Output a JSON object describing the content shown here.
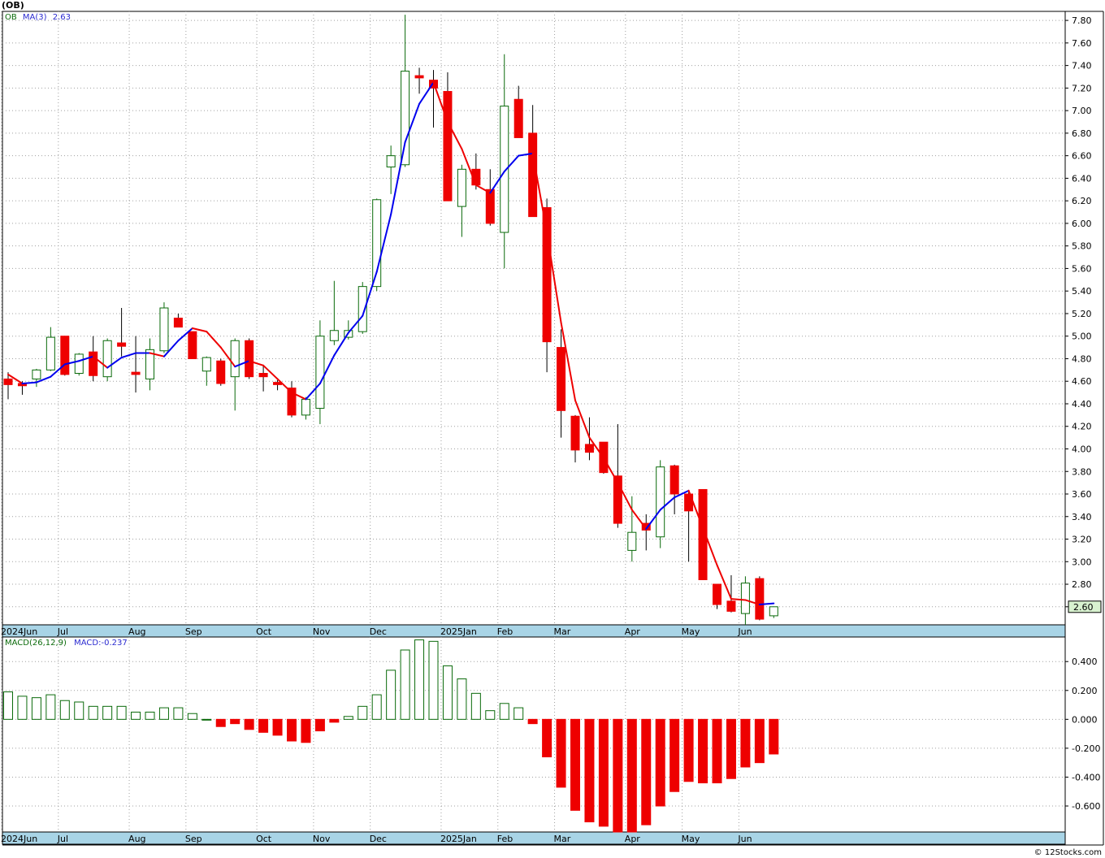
{
  "title": "(OB)",
  "price_legend": {
    "symbol": "OB",
    "ma_label": "MA(3)",
    "ma_value": "2.63"
  },
  "macd_legend": {
    "label": "MACD(26,12,9)",
    "value_label": "MACD:-0.237"
  },
  "last_price_label": "2.60",
  "credit": "© 12Stocks.com",
  "colors": {
    "up": "#0a6a0a",
    "down": "#ee0000",
    "ma_up": "#0000ee",
    "ma_down": "#ee0000",
    "axis_band": "#a8d4e6",
    "grid": "#a0a0a0",
    "price_tag": "#d8f2d0"
  },
  "chart_data": [
    {
      "type": "candlestick",
      "ylim": [
        2.44,
        7.88
      ],
      "y_ticks": [
        "7.80",
        "7.60",
        "7.40",
        "7.20",
        "7.00",
        "6.80",
        "6.60",
        "6.40",
        "6.20",
        "6.00",
        "5.80",
        "5.60",
        "5.40",
        "5.20",
        "5.00",
        "4.80",
        "4.60",
        "4.40",
        "4.20",
        "4.00",
        "3.80",
        "3.60",
        "3.40",
        "3.20",
        "3.00",
        "2.80",
        "2.60"
      ],
      "x_labels": [
        {
          "i": 0,
          "label": "2024Jun"
        },
        {
          "i": 4,
          "label": "Jul"
        },
        {
          "i": 9,
          "label": "Aug"
        },
        {
          "i": 13,
          "label": "Sep"
        },
        {
          "i": 18,
          "label": "Oct"
        },
        {
          "i": 22,
          "label": "Nov"
        },
        {
          "i": 26,
          "label": "Dec"
        },
        {
          "i": 31,
          "label": "2025Jan"
        },
        {
          "i": 35,
          "label": "Feb"
        },
        {
          "i": 39,
          "label": "Mar"
        },
        {
          "i": 44,
          "label": "Apr"
        },
        {
          "i": 48,
          "label": "May"
        },
        {
          "i": 52,
          "label": "Jun"
        }
      ],
      "candles": [
        {
          "o": 4.62,
          "h": 4.68,
          "l": 4.44,
          "c": 4.57
        },
        {
          "o": 4.58,
          "h": 4.6,
          "l": 4.48,
          "c": 4.56
        },
        {
          "o": 4.62,
          "h": 4.71,
          "l": 4.55,
          "c": 4.7
        },
        {
          "o": 4.7,
          "h": 5.08,
          "l": 4.69,
          "c": 4.99
        },
        {
          "o": 5.0,
          "h": 5.0,
          "l": 4.65,
          "c": 4.66
        },
        {
          "o": 4.67,
          "h": 4.85,
          "l": 4.65,
          "c": 4.84
        },
        {
          "o": 4.86,
          "h": 5.0,
          "l": 4.6,
          "c": 4.65
        },
        {
          "o": 4.64,
          "h": 4.98,
          "l": 4.6,
          "c": 4.96
        },
        {
          "o": 4.94,
          "h": 5.25,
          "l": 4.82,
          "c": 4.91
        },
        {
          "o": 4.68,
          "h": 5.0,
          "l": 4.5,
          "c": 4.66
        },
        {
          "o": 4.62,
          "h": 4.98,
          "l": 4.52,
          "c": 4.88
        },
        {
          "o": 4.87,
          "h": 5.3,
          "l": 4.85,
          "c": 5.25
        },
        {
          "o": 5.16,
          "h": 5.2,
          "l": 5.08,
          "c": 5.08
        },
        {
          "o": 5.04,
          "h": 5.04,
          "l": 4.8,
          "c": 4.8
        },
        {
          "o": 4.69,
          "h": 4.82,
          "l": 4.56,
          "c": 4.81
        },
        {
          "o": 4.78,
          "h": 4.8,
          "l": 4.56,
          "c": 4.58
        },
        {
          "o": 4.64,
          "h": 4.98,
          "l": 4.34,
          "c": 4.96
        },
        {
          "o": 4.96,
          "h": 4.98,
          "l": 4.62,
          "c": 4.64
        },
        {
          "o": 4.67,
          "h": 4.74,
          "l": 4.51,
          "c": 4.64
        },
        {
          "o": 4.59,
          "h": 4.61,
          "l": 4.52,
          "c": 4.57
        },
        {
          "o": 4.54,
          "h": 4.6,
          "l": 4.28,
          "c": 4.3
        },
        {
          "o": 4.3,
          "h": 4.46,
          "l": 4.26,
          "c": 4.44
        },
        {
          "o": 4.36,
          "h": 5.14,
          "l": 4.22,
          "c": 5.0
        },
        {
          "o": 4.96,
          "h": 5.49,
          "l": 4.92,
          "c": 5.05
        },
        {
          "o": 4.99,
          "h": 5.14,
          "l": 4.97,
          "c": 5.05
        },
        {
          "o": 5.04,
          "h": 5.48,
          "l": 5.02,
          "c": 5.44
        },
        {
          "o": 5.44,
          "h": 6.22,
          "l": 5.4,
          "c": 6.21
        },
        {
          "o": 6.5,
          "h": 6.69,
          "l": 6.26,
          "c": 6.6
        },
        {
          "o": 6.52,
          "h": 7.85,
          "l": 6.5,
          "c": 7.35
        },
        {
          "o": 7.31,
          "h": 7.38,
          "l": 7.15,
          "c": 7.29
        },
        {
          "o": 7.27,
          "h": 7.36,
          "l": 6.85,
          "c": 7.2
        },
        {
          "o": 7.17,
          "h": 7.34,
          "l": 6.2,
          "c": 6.2
        },
        {
          "o": 6.15,
          "h": 6.52,
          "l": 5.88,
          "c": 6.48
        },
        {
          "o": 6.48,
          "h": 6.62,
          "l": 6.3,
          "c": 6.34
        },
        {
          "o": 6.3,
          "h": 6.48,
          "l": 5.98,
          "c": 6.0
        },
        {
          "o": 5.92,
          "h": 7.5,
          "l": 5.6,
          "c": 7.04
        },
        {
          "o": 7.1,
          "h": 7.22,
          "l": 6.76,
          "c": 6.76
        },
        {
          "o": 6.8,
          "h": 7.05,
          "l": 6.06,
          "c": 6.06
        },
        {
          "o": 6.14,
          "h": 6.22,
          "l": 4.68,
          "c": 4.95
        },
        {
          "o": 4.9,
          "h": 5.06,
          "l": 4.1,
          "c": 4.34
        },
        {
          "o": 4.29,
          "h": 4.3,
          "l": 3.88,
          "c": 3.99
        },
        {
          "o": 4.04,
          "h": 4.28,
          "l": 3.9,
          "c": 3.97
        },
        {
          "o": 4.06,
          "h": 4.06,
          "l": 3.78,
          "c": 3.79
        },
        {
          "o": 3.76,
          "h": 4.22,
          "l": 3.3,
          "c": 3.34
        },
        {
          "o": 3.1,
          "h": 3.58,
          "l": 3.0,
          "c": 3.26
        },
        {
          "o": 3.34,
          "h": 3.42,
          "l": 3.1,
          "c": 3.28
        },
        {
          "o": 3.22,
          "h": 3.9,
          "l": 3.12,
          "c": 3.84
        },
        {
          "o": 3.85,
          "h": 3.86,
          "l": 3.42,
          "c": 3.6
        },
        {
          "o": 3.6,
          "h": 3.62,
          "l": 3.0,
          "c": 3.45
        },
        {
          "o": 3.64,
          "h": 3.64,
          "l": 2.84,
          "c": 2.84
        },
        {
          "o": 2.8,
          "h": 2.8,
          "l": 2.58,
          "c": 2.62
        },
        {
          "o": 2.65,
          "h": 2.88,
          "l": 2.55,
          "c": 2.56
        },
        {
          "o": 2.54,
          "h": 2.87,
          "l": 2.44,
          "c": 2.81
        },
        {
          "o": 2.85,
          "h": 2.87,
          "l": 2.48,
          "c": 2.49
        },
        {
          "o": 2.52,
          "h": 2.6,
          "l": 2.5,
          "c": 2.6
        }
      ],
      "ma3": [
        4.66,
        4.58,
        4.59,
        4.64,
        4.75,
        4.78,
        4.82,
        4.72,
        4.81,
        4.85,
        4.85,
        4.82,
        4.96,
        5.07,
        5.04,
        4.9,
        4.73,
        4.78,
        4.74,
        4.62,
        4.5,
        4.44,
        4.58,
        4.83,
        5.03,
        5.18,
        5.57,
        6.08,
        6.72,
        7.06,
        7.25,
        6.9,
        6.66,
        6.34,
        6.27,
        6.46,
        6.6,
        6.62,
        5.92,
        5.12,
        4.43,
        4.1,
        3.92,
        3.7,
        3.46,
        3.29,
        3.46,
        3.57,
        3.63,
        3.3,
        2.97,
        2.67,
        2.66,
        2.62,
        2.63
      ]
    },
    {
      "type": "bar",
      "name": "MACD(26,12,9)",
      "ylim": [
        -0.78,
        0.57
      ],
      "y_ticks": [
        "0.400",
        "0.200",
        "0.000",
        "-0.200",
        "-0.400",
        "-0.600"
      ],
      "values": [
        0.19,
        0.16,
        0.15,
        0.17,
        0.13,
        0.12,
        0.09,
        0.09,
        0.09,
        0.05,
        0.05,
        0.08,
        0.08,
        0.04,
        0.0,
        -0.05,
        -0.03,
        -0.07,
        -0.09,
        -0.11,
        -0.15,
        -0.16,
        -0.08,
        -0.02,
        0.02,
        0.09,
        0.17,
        0.34,
        0.48,
        0.55,
        0.54,
        0.37,
        0.28,
        0.18,
        0.06,
        0.11,
        0.08,
        -0.03,
        -0.26,
        -0.47,
        -0.63,
        -0.71,
        -0.74,
        -0.78,
        -0.78,
        -0.73,
        -0.6,
        -0.5,
        -0.43,
        -0.44,
        -0.44,
        -0.41,
        -0.33,
        -0.3,
        -0.24
      ]
    }
  ]
}
